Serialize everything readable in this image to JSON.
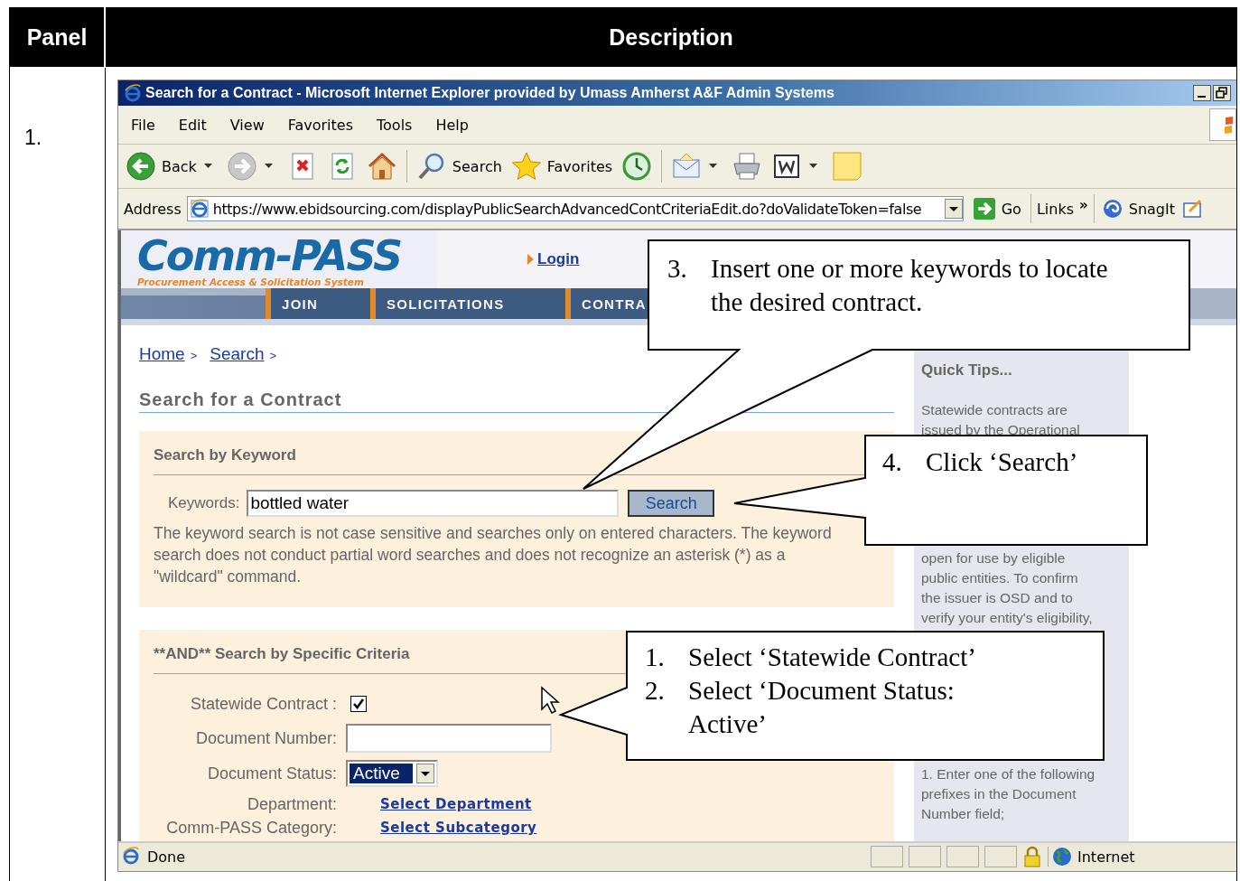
{
  "table": {
    "columns": [
      "Panel",
      "Description"
    ],
    "rows": [
      {
        "panel": "1."
      }
    ]
  },
  "browser": {
    "title": "Search for a Contract - Microsoft Internet Explorer provided by Umass Amherst A&F Admin Systems",
    "menu": [
      "File",
      "Edit",
      "View",
      "Favorites",
      "Tools",
      "Help"
    ],
    "toolbar": [
      {
        "kind": "back",
        "label": "Back",
        "dropdown": true
      },
      {
        "kind": "forward",
        "dropdown": true
      },
      {
        "kind": "stop"
      },
      {
        "kind": "refresh"
      },
      {
        "kind": "home"
      },
      {
        "kind": "search",
        "label": "Search"
      },
      {
        "kind": "favorites",
        "label": "Favorites"
      },
      {
        "kind": "history"
      },
      {
        "kind": "mail",
        "dropdown": true
      },
      {
        "kind": "print"
      },
      {
        "kind": "word",
        "dropdown": true
      },
      {
        "kind": "note"
      }
    ],
    "address": {
      "label": "Address",
      "url": "https://www.ebidsourcing.com/displayPublicSearchAdvancedContCriteriaEdit.do?doValidateToken=false",
      "go": "Go",
      "links": "Links",
      "chevron": "»",
      "snagit": "SnagIt"
    },
    "status": {
      "text": "Done",
      "zone": "Internet"
    }
  },
  "page": {
    "logo": {
      "name": "Comm-PASS",
      "tagline": "Procurement Access & Solicitation System"
    },
    "login": "Login",
    "nav": [
      "JOIN",
      "SOLICITATIONS",
      "CONTRA"
    ],
    "breadcrumb": [
      {
        "label": "Home",
        "sep": ">"
      },
      {
        "label": "Search",
        "sep": ">"
      }
    ],
    "heading": "Search for a Contract",
    "keyword_section": {
      "title": "Search by Keyword",
      "label": "Keywords:",
      "value": "bottled water",
      "button": "Search",
      "note": "The keyword search is not case sensitive and searches only on entered characters. The keyword search does not conduct partial word searches and does not recognize an asterisk (*) as a \"wildcard\" command."
    },
    "criteria_section": {
      "title": "**AND** Search by Specific Criteria",
      "fields": [
        {
          "kind": "checkbox",
          "label": "Statewide Contract :",
          "checked": true
        },
        {
          "kind": "text",
          "label": "Document Number:"
        },
        {
          "kind": "select",
          "label": "Document Status:",
          "value": "Active"
        },
        {
          "kind": "link",
          "label": "Department:",
          "link": "Select Department"
        },
        {
          "kind": "link",
          "label": "Comm-PASS Category:",
          "link": "Select Subcategory"
        }
      ]
    },
    "tips": {
      "title": "Quick Tips...",
      "paragraphs": [
        [
          "Statewide contracts are",
          "issued by the Operational"
        ],
        [
          "open for use by eligible",
          "public entities.   To confirm",
          "the issuer is OSD and to",
          "verify your entity's eligibility,"
        ],
        [
          "1. Enter one of the following",
          "prefixes in the Document",
          "Number field;"
        ]
      ]
    }
  },
  "callouts": [
    {
      "items": [
        {
          "number": "3.",
          "text": "Insert one or more keywords to locate the desired contract."
        }
      ]
    },
    {
      "items": [
        {
          "number": "4.",
          "text": "Click ‘Search’"
        }
      ]
    },
    {
      "items": [
        {
          "number": "1.",
          "text": "Select ‘Statewide Contract’"
        },
        {
          "number": "2.",
          "text": "Select ‘Document Status: Active’"
        }
      ]
    }
  ]
}
